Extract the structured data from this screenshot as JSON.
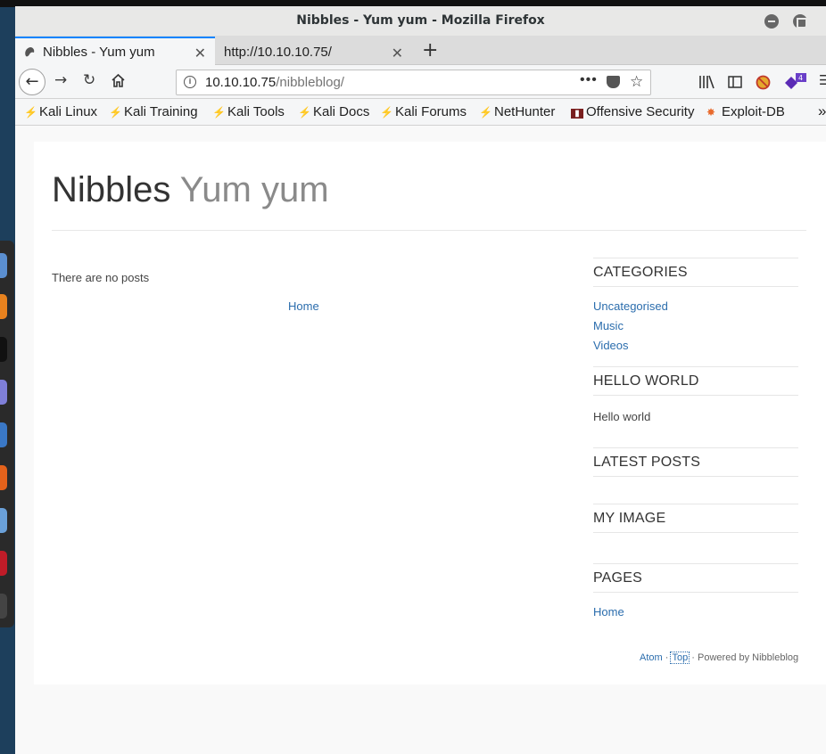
{
  "window": {
    "title": "Nibbles - Yum yum - Mozilla Firefox"
  },
  "tabs": [
    {
      "label": "Nibbles - Yum yum",
      "active": true
    },
    {
      "label": "http://10.10.10.75/",
      "active": false
    }
  ],
  "navbar": {
    "url_host": "10.10.10.75",
    "url_path": "/nibbleblog/",
    "more_label": "•••",
    "addon_badge": "4"
  },
  "bookmarks": [
    "Kali Linux",
    "Kali Training",
    "Kali Tools",
    "Kali Docs",
    "Kali Forums",
    "NetHunter",
    "Offensive Security",
    "Exploit-DB"
  ],
  "blog": {
    "name": "Nibbles",
    "slogan": "Yum yum",
    "no_posts": "There are no posts",
    "home_link": "Home"
  },
  "sidebar": {
    "categories_title": "CATEGORIES",
    "categories": [
      "Uncategorised",
      "Music",
      "Videos"
    ],
    "hello_title": "HELLO WORLD",
    "hello_text": "Hello world",
    "latest_title": "LATEST POSTS",
    "image_title": "MY IMAGE",
    "pages_title": "PAGES",
    "pages": [
      "Home"
    ]
  },
  "footer": {
    "atom": "Atom",
    "sep1": "·",
    "top": "Top",
    "powered": "· Powered by Nibbleblog"
  },
  "colors": {
    "link": "#2b6dad",
    "tab_accent": "#0a84ff",
    "desktop": "#1d3f5c"
  }
}
